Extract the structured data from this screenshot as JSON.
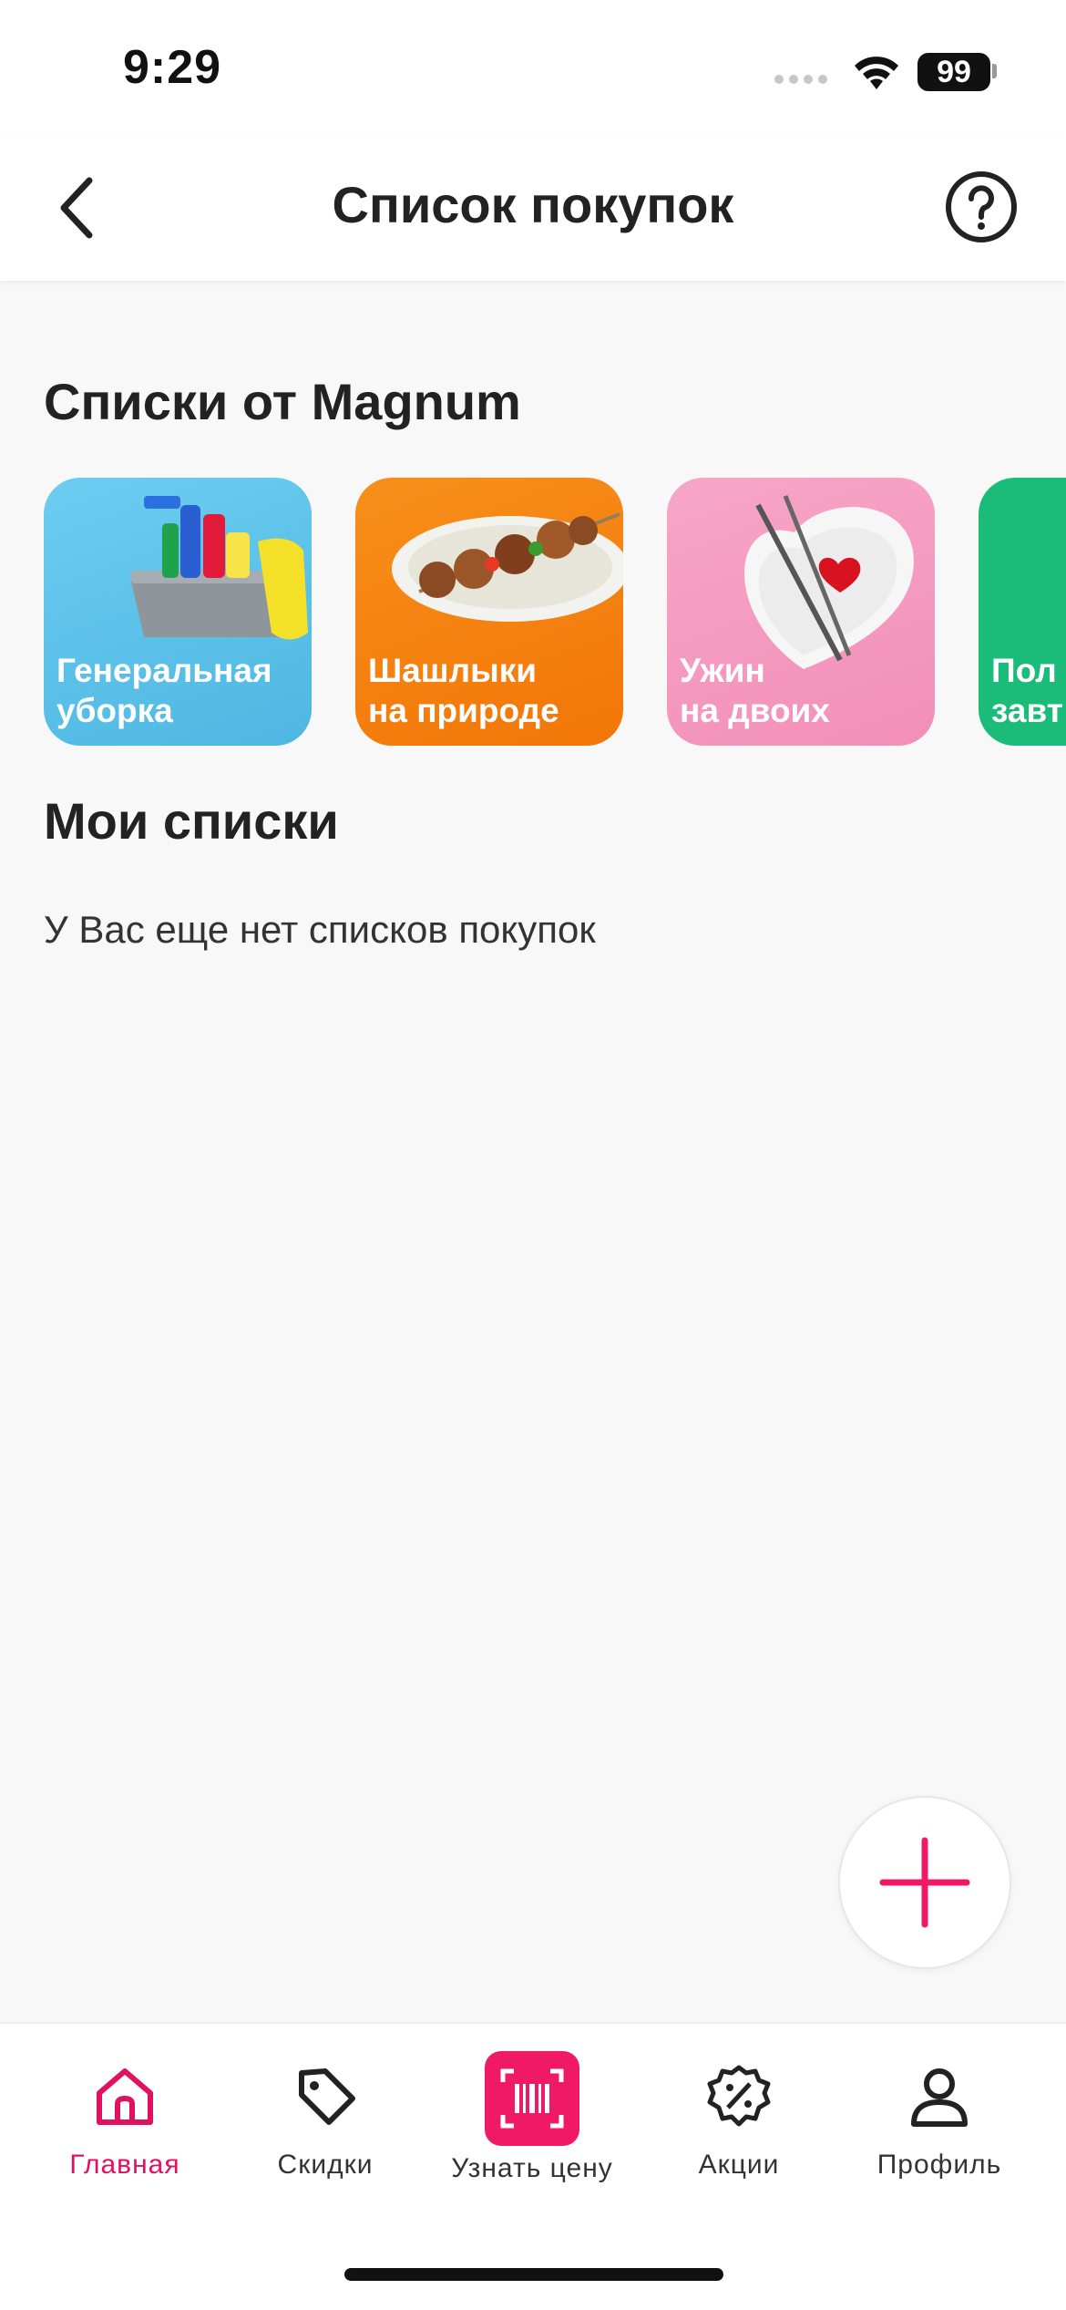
{
  "status": {
    "time": "9:29",
    "battery": "99"
  },
  "header": {
    "title": "Список покупок"
  },
  "magnum_lists": {
    "title": "Списки от Magnum",
    "cards": [
      {
        "label": "Генеральная\nуборка",
        "color": "#5bc3e8"
      },
      {
        "label": "Шашлыки\nна природе",
        "color": "#f68712"
      },
      {
        "label": "Ужин\nна двоих",
        "color": "#f59ac0"
      },
      {
        "label": "Пол\nзавт",
        "color": "#1bbc7a"
      }
    ]
  },
  "my_lists": {
    "title": "Мои списки",
    "empty_text": "У Вас еще нет списков покупок"
  },
  "tabbar": {
    "items": [
      {
        "label": "Главная",
        "icon": "home-icon",
        "active": true
      },
      {
        "label": "Скидки",
        "icon": "tag-icon"
      },
      {
        "label": "Узнать цену",
        "icon": "barcode-scan-icon"
      },
      {
        "label": "Акции",
        "icon": "percent-badge-icon"
      },
      {
        "label": "Профиль",
        "icon": "user-icon"
      }
    ]
  },
  "colors": {
    "accent": "#f01965",
    "background": "#f8f8f8"
  }
}
